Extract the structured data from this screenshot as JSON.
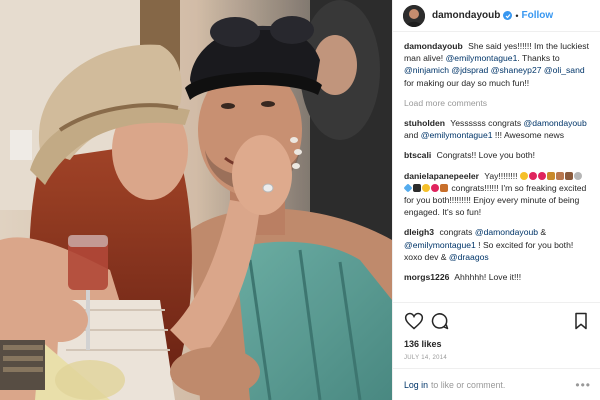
{
  "header": {
    "username": "damondayoub",
    "follow_label": "Follow",
    "separator": "•"
  },
  "caption": {
    "username": "damondayoub",
    "text_before": " She said yes!!!!!! Im the luckiest man alive! ",
    "mention1": "@emilymontague1",
    "text_mid": ". Thanks to ",
    "mention2": "@ninjamich",
    "mention3": "@jdsprad",
    "mention4": "@shaneyp27",
    "mention5": "@oli_sand",
    "text_after": " for making our day so much fun!!"
  },
  "load_more": "Load more comments",
  "comments": [
    {
      "username": "stuholden",
      "text_before": " Yessssss congrats ",
      "mention1": "@damondayoub",
      "text_mid": " and ",
      "mention2": "@emilymontague1",
      "text_after": " !!! Awesome news"
    },
    {
      "username": "btscali",
      "text": " Congrats!! Love you both!"
    },
    {
      "username": "danielapanepeeler",
      "text_before": " Yay!!!!!!!!",
      "text_after": " congrats!!!!!! I'm so freaking excited for you both!!!!!!!!! Enjoy every minute of being engaged. It's so fun!"
    },
    {
      "username": "dleigh3",
      "text_before": " congrats ",
      "mention1": "@damondayoub",
      "text_mid": " & ",
      "mention2": "@emilymontague1",
      "text_mid2": " ! So excited for you both! xoxo dev & ",
      "mention3": "@draagos"
    },
    {
      "username": "morgs1226",
      "text": " Ahhhhh! Love it!!!"
    }
  ],
  "actions": {
    "likes": "136 likes",
    "date": "JULY 14, 2014"
  },
  "login": {
    "link": "Log in",
    "text": "to like or comment.",
    "more": "•••"
  },
  "icons": {
    "header": [
      "avatar",
      "verified-badge-icon"
    ],
    "actions": [
      "heart-icon",
      "comment-icon",
      "bookmark-icon"
    ],
    "emoji": [
      "grin-emoji-icon",
      "heart-emoji-icon",
      "heart-emoji-icon",
      "trophy-emoji-icon",
      "bride-emoji-icon",
      "groom-emoji-icon",
      "ring-emoji-icon",
      "diamond-emoji-icon",
      "celebration-emoji-icon",
      "heart-emoji-icon",
      "heart-emoji-icon",
      "bouquet-emoji-icon"
    ]
  },
  "colors": {
    "link": "#003569",
    "follow": "#3897f0",
    "muted": "#999999",
    "text": "#262626",
    "border": "#efefef"
  }
}
